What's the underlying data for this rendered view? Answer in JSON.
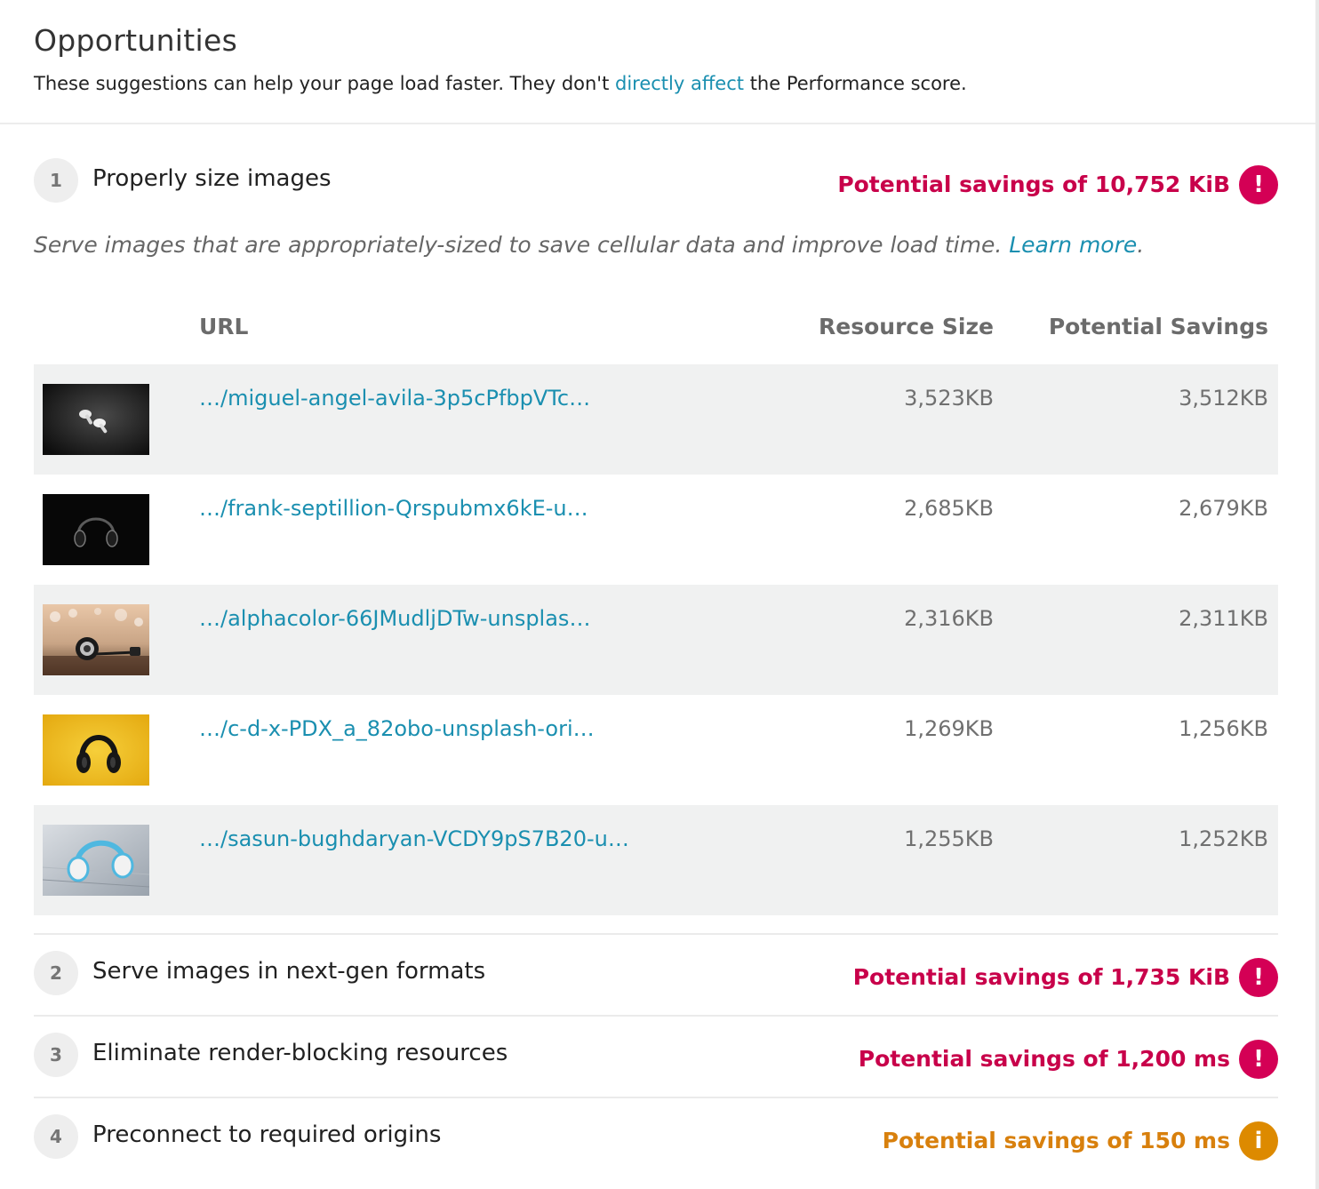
{
  "header": {
    "title": "Opportunities",
    "description_before": "These suggestions can help your page load faster. They don't ",
    "description_link": "directly affect",
    "description_after": " the Performance score."
  },
  "audits": [
    {
      "number": "1",
      "title": "Properly size images",
      "savings": "Potential savings of 10,752 KiB",
      "severity": "fail",
      "icon": "exclamation-icon",
      "description": "Serve images that are appropriately-sized to save cellular data and improve load time.",
      "learn_more": "Learn more",
      "table": {
        "columns": [
          "URL",
          "Resource Size",
          "Potential Savings"
        ],
        "rows": [
          {
            "url": "…/miguel-angel-avila-3p5cPfbpVTc…",
            "size": "3,523KB",
            "savings": "3,512KB",
            "thumbnail": "earbuds-on-dark-surface"
          },
          {
            "url": "…/frank-septillion-Qrspubmx6kE-u…",
            "size": "2,685KB",
            "savings": "2,679KB",
            "thumbnail": "headphones-on-black"
          },
          {
            "url": "…/alphacolor-66JMudljDTw-unsplas…",
            "size": "2,316KB",
            "savings": "2,311KB",
            "thumbnail": "headphones-on-bokeh-table"
          },
          {
            "url": "…/c-d-x-PDX_a_82obo-unsplash-ori…",
            "size": "1,269KB",
            "savings": "1,256KB",
            "thumbnail": "headphones-on-yellow"
          },
          {
            "url": "…/sasun-bughdaryan-VCDY9pS7B20-u…",
            "size": "1,255KB",
            "savings": "1,252KB",
            "thumbnail": "blue-white-headphones-on-wood"
          }
        ]
      }
    },
    {
      "number": "2",
      "title": "Serve images in next-gen formats",
      "savings": "Potential savings of 1,735 KiB",
      "severity": "fail",
      "icon": "exclamation-icon"
    },
    {
      "number": "3",
      "title": "Eliminate render-blocking resources",
      "savings": "Potential savings of 1,200 ms",
      "severity": "fail",
      "icon": "exclamation-icon"
    },
    {
      "number": "4",
      "title": "Preconnect to required origins",
      "savings": "Potential savings of 150 ms",
      "severity": "warn",
      "icon": "info-icon"
    }
  ],
  "colors": {
    "fail": "#d40055",
    "warn": "#dd8a00",
    "link": "#1a8fb0",
    "row_shade": "#f0f1f1"
  },
  "icon_glyphs": {
    "exclamation-icon": "!",
    "info-icon": "i"
  }
}
